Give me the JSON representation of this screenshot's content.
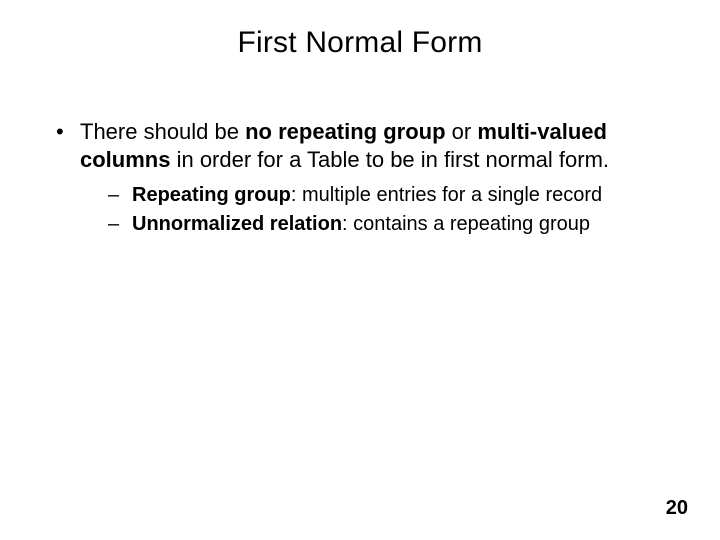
{
  "title": "First Normal Form",
  "main": {
    "pre": "There should be ",
    "bold1": "no repeating group",
    "mid": " or ",
    "bold2": "multi-valued columns",
    "post": " in order for a Table to be in first normal form."
  },
  "sub1": {
    "bold": "Repeating group",
    "rest": ": multiple entries for a single record"
  },
  "sub2": {
    "bold": "Unnormalized relation",
    "rest": ": contains a repeating group"
  },
  "page_number": "20"
}
